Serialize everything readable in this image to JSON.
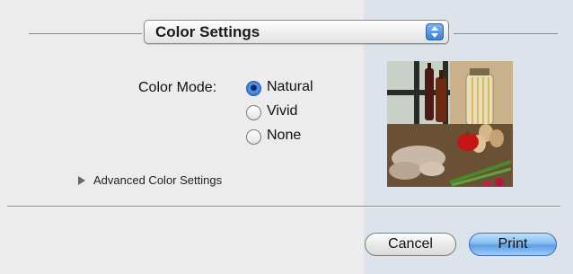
{
  "popup": {
    "selected": "Color Settings"
  },
  "color_mode": {
    "label": "Color Mode:",
    "options": [
      {
        "label": "Natural",
        "selected": true
      },
      {
        "label": "Vivid",
        "selected": false
      },
      {
        "label": "None",
        "selected": false
      }
    ]
  },
  "advanced": {
    "label": "Advanced Color Settings"
  },
  "preview_image": {
    "subject": "kitchen still life photo with bottles, vegetables, shrimp and eggs"
  },
  "buttons": {
    "cancel": "Cancel",
    "print": "Print"
  },
  "colors": {
    "accent_blue": "#5d9ee6",
    "panel": "#ececec"
  }
}
